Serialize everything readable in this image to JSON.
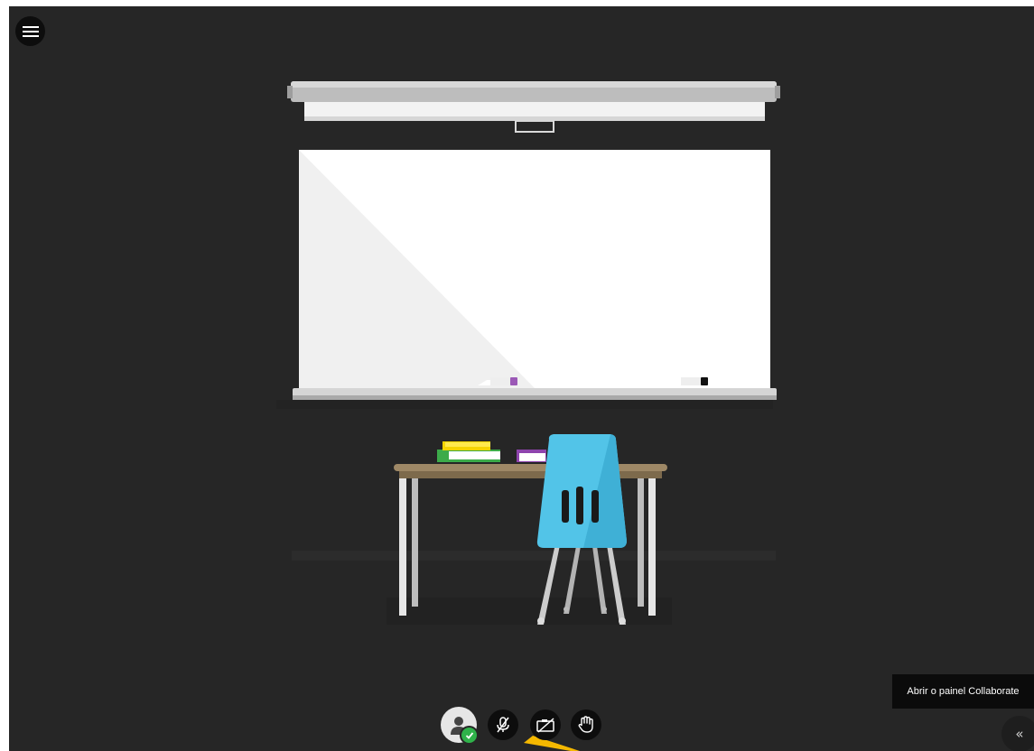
{
  "tooltip": {
    "text": "Abrir o painel Collaborate"
  },
  "panel_toggle": {
    "glyph": "«"
  },
  "controls": {
    "menu_icon": "hamburger-menu-icon",
    "avatar_icon": "user-avatar-icon",
    "status_icon": "checkmark-icon",
    "mic_icon": "microphone-muted-icon",
    "camera_icon": "camera-off-icon",
    "hand_icon": "raise-hand-icon"
  },
  "colors": {
    "stage_background": "#262626",
    "button_background": "#0d0d0d",
    "status_green": "#2fb24a",
    "chair_blue": "#52c4e8",
    "highlight_arrow": "#f5b800"
  }
}
